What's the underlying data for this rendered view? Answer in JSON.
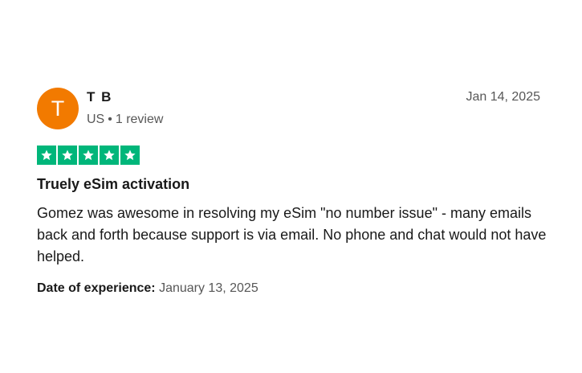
{
  "reviewer": {
    "initial": "T",
    "name": "T B",
    "country": "US",
    "separator": "•",
    "review_count": "1 review",
    "avatar_color": "#f27a00"
  },
  "review": {
    "date": "Jan 14, 2025",
    "rating": 5,
    "max_rating": 5,
    "star_color": "#00b67a",
    "title": "Truely eSim activation",
    "body": "Gomez was awesome in resolving my eSim \"no number issue\" - many emails back and forth because support is via email. No phone and chat would not have helped.",
    "experience_label": "Date of experience:",
    "experience_date": "January 13, 2025"
  }
}
